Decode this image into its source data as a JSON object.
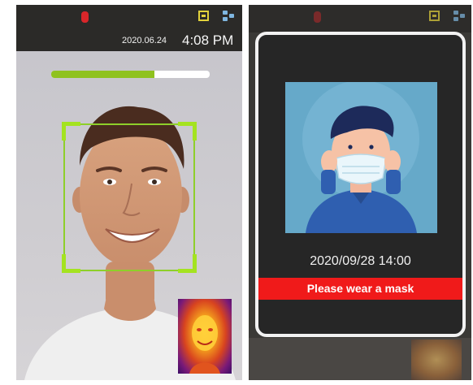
{
  "left_screen": {
    "status": {
      "record_icon": "red-record-icon",
      "camera_icon": "camera-mode-icon",
      "network_icon": "network-icon",
      "date": "2020.06.24",
      "time": "4:08 PM"
    },
    "scan_progress_percent": 65,
    "colors": {
      "face_frame": "#8ecf2a",
      "progress_fill": "#8fc21f",
      "record": "#d9262a"
    }
  },
  "right_screen": {
    "popup": {
      "datetime": "2020/09/28 14:00",
      "alert": "Please wear a mask"
    },
    "colors": {
      "alert_background": "#f01a1a",
      "popup_border": "#f2f2f2"
    }
  }
}
